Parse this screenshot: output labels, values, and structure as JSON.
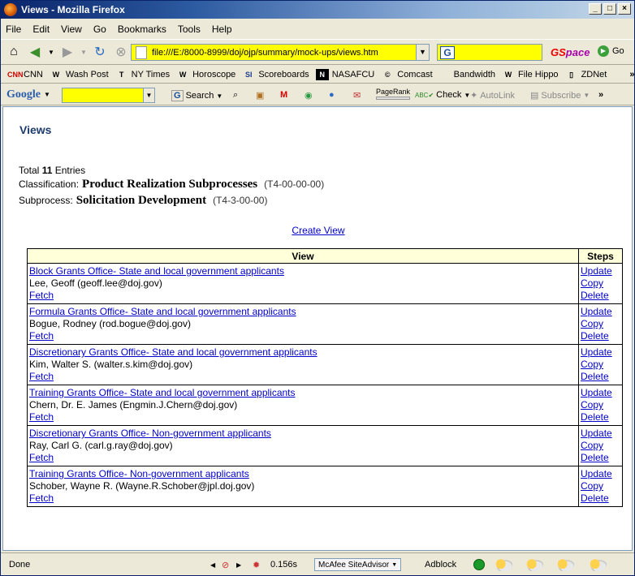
{
  "window": {
    "title": "Views - Mozilla Firefox"
  },
  "menu": [
    "File",
    "Edit",
    "View",
    "Go",
    "Bookmarks",
    "Tools",
    "Help"
  ],
  "nav": {
    "url": "file:///E:/8000-8999/doj/ojp/summary/mock-ups/views.htm",
    "gspace_a": "GS",
    "gspace_b": "pace",
    "go_label": "Go"
  },
  "bookmarks": [
    {
      "label": "CNN",
      "icon": "cnn-icon"
    },
    {
      "label": "Wash Post",
      "icon": "wp-icon"
    },
    {
      "label": "NY Times",
      "icon": "nyt-icon"
    },
    {
      "label": "Horoscope",
      "icon": "wp-icon"
    },
    {
      "label": "Scoreboards",
      "icon": "si-icon"
    },
    {
      "label": "NASAFCU",
      "icon": "nasa-icon"
    },
    {
      "label": "Comcast",
      "icon": "comcast-icon"
    },
    {
      "label": "Bandwidth",
      "icon": "none"
    },
    {
      "label": "File Hippo",
      "icon": "wp-icon"
    },
    {
      "label": "ZDNet",
      "icon": "page-icon"
    }
  ],
  "google_toolbar": {
    "logo": "Google",
    "search_label": "Search",
    "pagerank_label": "PageRank",
    "check_label": "Check",
    "autolink_label": "AutoLink",
    "subscribe_label": "Subscribe"
  },
  "page": {
    "heading": "Views",
    "total_prefix": "Total",
    "total_count": "11",
    "total_suffix": "Entries",
    "classification_label": "Classification:",
    "classification_value": "Product Realization Subprocesses",
    "classification_code": "(T4-00-00-00)",
    "subprocess_label": "Subprocess:",
    "subprocess_value": "Solicitation Development",
    "subprocess_code": "(T4-3-00-00)",
    "create_view": "Create View",
    "table_headers": {
      "view": "View",
      "steps": "Steps"
    },
    "action_labels": {
      "fetch": "Fetch",
      "update": "Update",
      "copy": "Copy",
      "delete": "Delete"
    },
    "rows": [
      {
        "title": "Block Grants Office- State and local government applicants",
        "owner": "Lee, Geoff (geoff.lee@doj.gov)"
      },
      {
        "title": "Formula Grants Office- State and local government applicants",
        "owner": "Bogue, Rodney (rod.bogue@doj.gov)"
      },
      {
        "title": "Discretionary Grants Office- State and local government applicants",
        "owner": "Kim, Walter S. (walter.s.kim@doj.gov)"
      },
      {
        "title": "Training Grants Office- State and local government applicants",
        "owner": "Chern, Dr. E. James (Engmin.J.Chern@doj.gov)"
      },
      {
        "title": "Discretionary Grants Office- Non-government applicants",
        "owner": "Ray, Carl G. (carl.g.ray@doj.gov)"
      },
      {
        "title": "Training Grants Office- Non-government applicants",
        "owner": "Schober, Wayne R. (Wayne.R.Schober@jpl.doj.gov)"
      }
    ]
  },
  "status": {
    "text": "Done",
    "timing": "0.156s",
    "mcafee": "McAfee SiteAdvisor",
    "adblock": "Adblock"
  }
}
